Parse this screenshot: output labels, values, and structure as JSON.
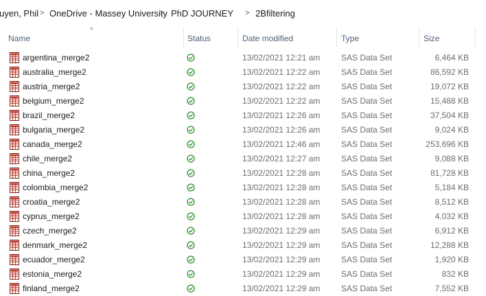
{
  "breadcrumb": {
    "items": [
      "uyen, Phil",
      "OneDrive - Massey University",
      "PhD JOURNEY",
      "2Bfiltering"
    ],
    "separator": ">"
  },
  "columns": {
    "name": "Name",
    "status": "Status",
    "date": "Date modified",
    "type": "Type",
    "size": "Size"
  },
  "files": [
    {
      "name": "argentina_merge2",
      "date": "13/02/2021 12:21 am",
      "type": "SAS Data Set",
      "size": "6,464 KB"
    },
    {
      "name": "australia_merge2",
      "date": "13/02/2021 12:22 am",
      "type": "SAS Data Set",
      "size": "86,592 KB"
    },
    {
      "name": "austria_merge2",
      "date": "13/02/2021 12:22 am",
      "type": "SAS Data Set",
      "size": "19,072 KB"
    },
    {
      "name": "belgium_merge2",
      "date": "13/02/2021 12:22 am",
      "type": "SAS Data Set",
      "size": "15,488 KB"
    },
    {
      "name": "brazil_merge2",
      "date": "13/02/2021 12:26 am",
      "type": "SAS Data Set",
      "size": "37,504 KB"
    },
    {
      "name": "bulgaria_merge2",
      "date": "13/02/2021 12:26 am",
      "type": "SAS Data Set",
      "size": "9,024 KB"
    },
    {
      "name": "canada_merge2",
      "date": "13/02/2021 12:46 am",
      "type": "SAS Data Set",
      "size": "253,696 KB"
    },
    {
      "name": "chile_merge2",
      "date": "13/02/2021 12:27 am",
      "type": "SAS Data Set",
      "size": "9,088 KB"
    },
    {
      "name": "china_merge2",
      "date": "13/02/2021 12:28 am",
      "type": "SAS Data Set",
      "size": "81,728 KB"
    },
    {
      "name": "colombia_merge2",
      "date": "13/02/2021 12:28 am",
      "type": "SAS Data Set",
      "size": "5,184 KB"
    },
    {
      "name": "croatia_merge2",
      "date": "13/02/2021 12:28 am",
      "type": "SAS Data Set",
      "size": "8,512 KB"
    },
    {
      "name": "cyprus_merge2",
      "date": "13/02/2021 12:28 am",
      "type": "SAS Data Set",
      "size": "4,032 KB"
    },
    {
      "name": "czech_merge2",
      "date": "13/02/2021 12:29 am",
      "type": "SAS Data Set",
      "size": "6,912 KB"
    },
    {
      "name": "denmark_merge2",
      "date": "13/02/2021 12:29 am",
      "type": "SAS Data Set",
      "size": "12,288 KB"
    },
    {
      "name": "ecuador_merge2",
      "date": "13/02/2021 12:29 am",
      "type": "SAS Data Set",
      "size": "1,920 KB"
    },
    {
      "name": "estonia_merge2",
      "date": "13/02/2021 12:29 am",
      "type": "SAS Data Set",
      "size": "832 KB"
    },
    {
      "name": "finland_merge2",
      "date": "13/02/2021 12:29 am",
      "type": "SAS Data Set",
      "size": "7,552 KB"
    }
  ],
  "icons": {
    "file": "sas-dataset-icon",
    "status": "synced-check-icon",
    "sort": "sort-up-icon"
  },
  "colors": {
    "status_green": "#2e8b2e",
    "file_icon_red": "#c0392b",
    "header_text": "#4c607a"
  }
}
